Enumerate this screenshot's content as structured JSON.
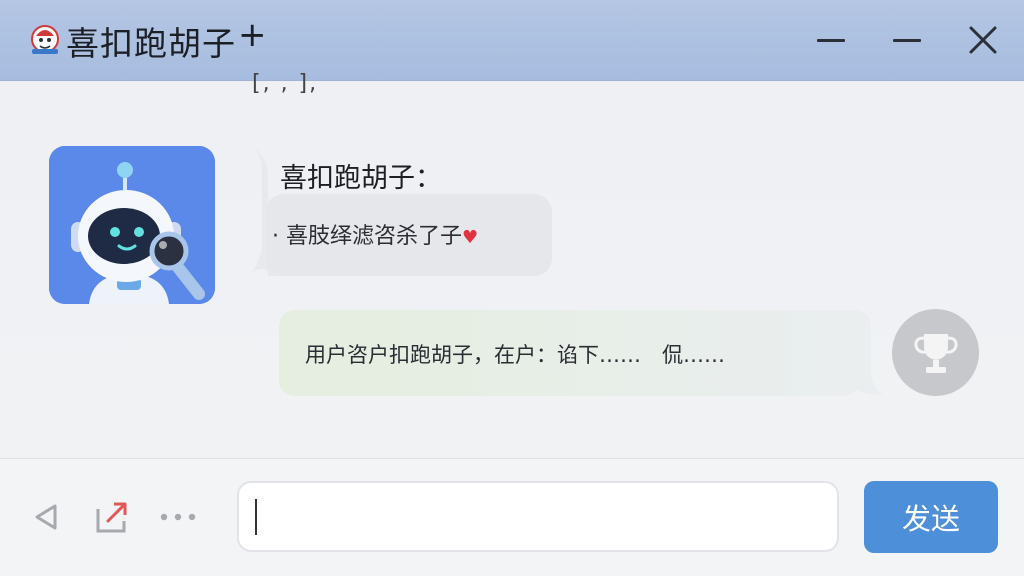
{
  "window": {
    "title": "喜扣跑胡子",
    "title_suffix": "+"
  },
  "chat": {
    "cut_off_text": "[, , ],",
    "bot": {
      "name": "喜扣跑胡子：",
      "message": "· 喜肢绎滤咨杀了子",
      "heart": "♥"
    },
    "user": {
      "message": "用户咨户扣跑胡子，在户：谄下……　侃……"
    }
  },
  "input": {
    "value": "",
    "send_label": "发送"
  },
  "icons": {
    "app": "app-logo-icon",
    "minimize": "minimize-icon",
    "close": "close-icon",
    "back": "back-triangle-icon",
    "share": "share-icon",
    "more": "more-dots-icon",
    "bot_avatar": "robot-avatar-icon",
    "user_avatar": "trophy-avatar-icon"
  },
  "colors": {
    "titlebar": "#a7bcdf",
    "send_button": "#4d8fd8",
    "bot_avatar_bg": "#5a87ea",
    "heart": "#e1323f",
    "user_bubble": "#e8efe2"
  }
}
